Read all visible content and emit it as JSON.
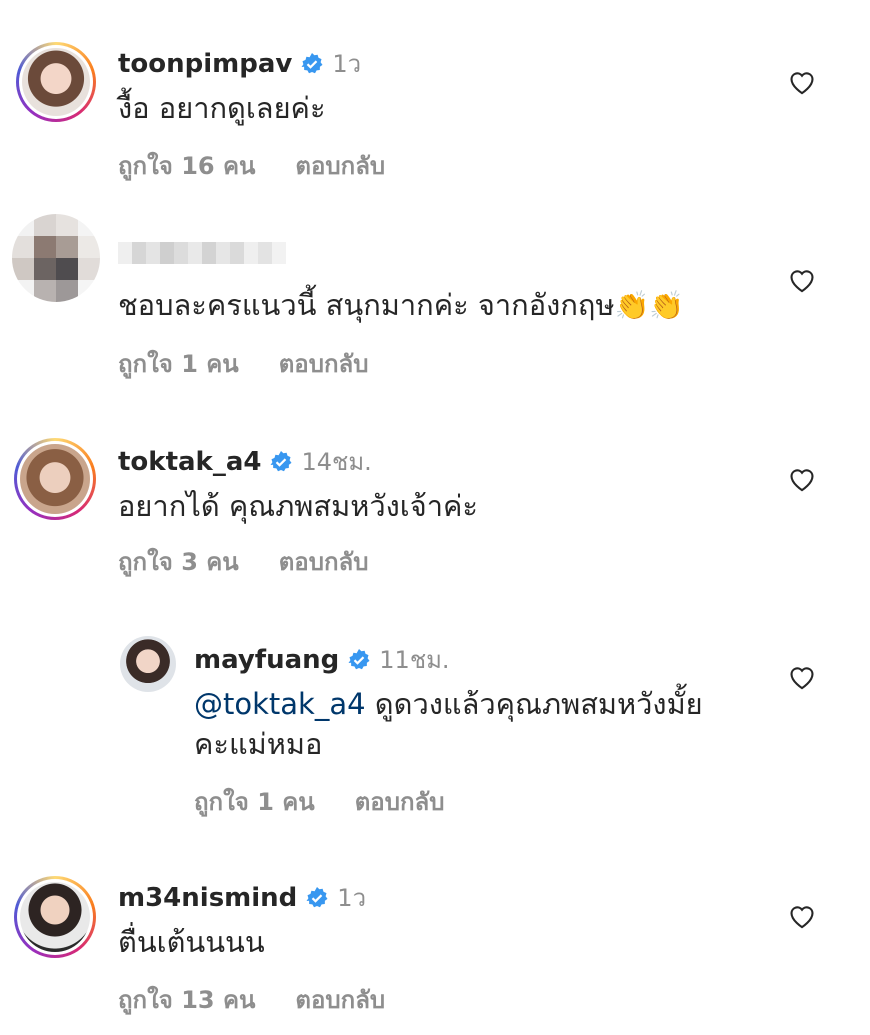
{
  "comments": [
    {
      "username": "toonpimpav",
      "verified": true,
      "time": "1ว",
      "text": "งื้อ อยากดูเลยค่ะ",
      "likes": "ถูกใจ 16 คน",
      "reply": "ตอบกลับ"
    },
    {
      "username": "",
      "verified": false,
      "time": "",
      "text": "ชอบละครแนวนี้ สนุกมากค่ะ จากอังกฤษ",
      "emoji": "👏👏",
      "likes": "ถูกใจ 1 คน",
      "reply": "ตอบกลับ"
    },
    {
      "username": "toktak_a4",
      "verified": true,
      "time": "14ชม.",
      "text": "อยากได้ คุณภพสมหวังเจ้าค่ะ",
      "likes": "ถูกใจ 3 คน",
      "reply": "ตอบกลับ"
    },
    {
      "username": "mayfuang",
      "verified": true,
      "time": "11ชม.",
      "mention": "@toktak_a4",
      "text": " ดูดวงแล้วคุณภพสมหวังมั้ย",
      "text_line2": "คะแม่หมอ",
      "likes": "ถูกใจ 1 คน",
      "reply": "ตอบกลับ"
    },
    {
      "username": "m34nismind",
      "verified": true,
      "time": "1ว",
      "text": "ตื่นเต้นนนน",
      "likes": "ถูกใจ 13 คน",
      "reply": "ตอบกลับ"
    }
  ],
  "icons": {
    "heart": "heart-outline-icon",
    "verified": "verified-badge-icon"
  },
  "colors": {
    "verified": "#3897f0",
    "muted": "#8e8e8e",
    "mention": "#00376b"
  }
}
